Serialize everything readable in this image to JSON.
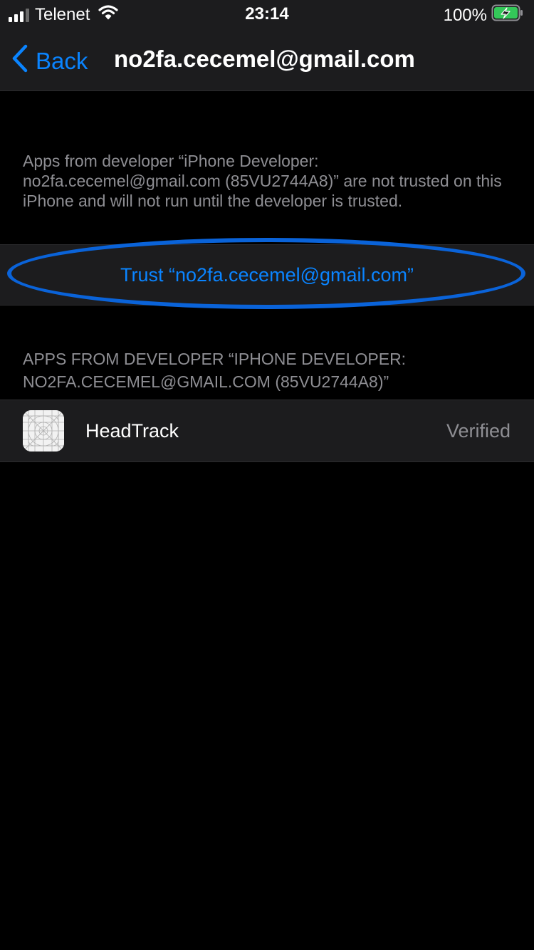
{
  "status_bar": {
    "carrier": "Telenet",
    "time": "23:14",
    "battery": "100%",
    "signal_bars_filled": 3,
    "signal_bars_total": 4,
    "icons": [
      "signal-icon",
      "wifi-icon",
      "battery-charging-icon"
    ]
  },
  "nav": {
    "back_label": "Back",
    "title": "no2fa.cecemel@gmail.com"
  },
  "description": "Apps from developer “iPhone Developer: no2fa.cecemel@gmail.com (85VU2744A8)” are not trusted on this iPhone and will not run until the developer is trusted.",
  "trust": {
    "label": "Trust “no2fa.cecemel@gmail.com”"
  },
  "apps_section": {
    "header": "APPS FROM DEVELOPER “IPHONE DEVELOPER: NO2FA.CECEMEL@GMAIL.COM (85VU2744A8)”",
    "items": [
      {
        "name": "HeadTrack",
        "status": "Verified",
        "icon": "app-placeholder-icon"
      }
    ]
  },
  "colors": {
    "accent": "#0a84ff",
    "highlight": "#0a63d9",
    "background": "#000000",
    "row_background": "#1c1c1e",
    "secondary_text": "#8e8e93",
    "battery_green": "#34c759"
  }
}
